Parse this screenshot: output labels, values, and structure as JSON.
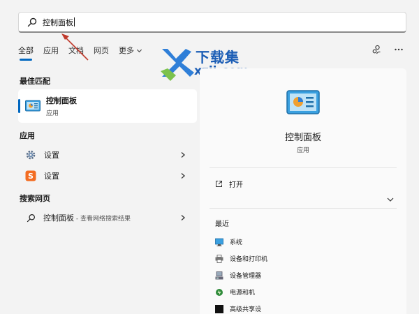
{
  "search": {
    "query": "控制面板"
  },
  "tabs": [
    {
      "label": "全部"
    },
    {
      "label": "应用"
    },
    {
      "label": "文档"
    },
    {
      "label": "网页"
    },
    {
      "label": "更多"
    }
  ],
  "watermark": {
    "title": "下载集",
    "url": "xzji.com"
  },
  "left": {
    "best_match_title": "最佳匹配",
    "best_match": {
      "name": "控制面板",
      "type": "应用"
    },
    "apps_title": "应用",
    "apps": [
      {
        "label": "设置",
        "icon": "gear-icon"
      },
      {
        "label": "设置",
        "icon": "sogou-s-icon"
      }
    ],
    "web_title": "搜索网页",
    "web_result": {
      "label": "控制面板",
      "suffix": " - 查看网络搜索结果"
    }
  },
  "right": {
    "app_name": "控制面板",
    "app_type": "应用",
    "open_label": "打开",
    "recent_title": "最近",
    "recent": [
      {
        "label": "系统",
        "icon": "system-icon"
      },
      {
        "label": "设备和打印机",
        "icon": "printer-icon"
      },
      {
        "label": "设备管理器",
        "icon": "device-manager-icon"
      },
      {
        "label": "电源和机",
        "icon": "power-icon"
      },
      {
        "label": "高级共享设",
        "icon": "sharing-icon"
      }
    ]
  },
  "colors": {
    "accent": "#0067c0",
    "watermark": "#1b5db5",
    "arrow": "#c0392b"
  }
}
